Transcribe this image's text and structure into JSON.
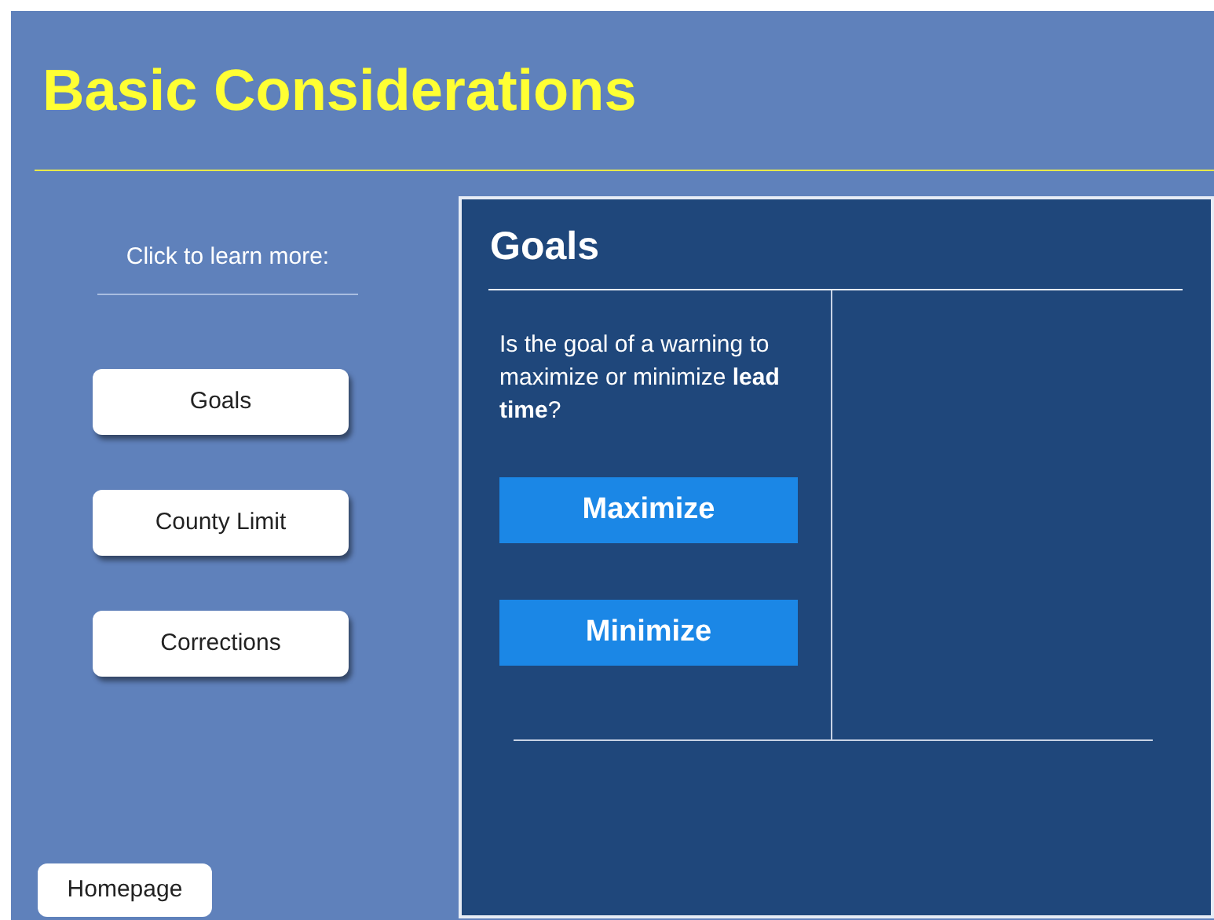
{
  "title": "Basic Considerations",
  "sidebar": {
    "prompt": "Click to learn more:",
    "buttons": [
      {
        "label": "Goals"
      },
      {
        "label": "County Limit"
      },
      {
        "label": "Corrections"
      }
    ]
  },
  "panel": {
    "heading": "Goals",
    "question": "Is the goal of a warning to maximize or minimize **lead time**?",
    "answers": [
      "Maximize",
      "Minimize"
    ]
  },
  "home_button": "Homepage"
}
